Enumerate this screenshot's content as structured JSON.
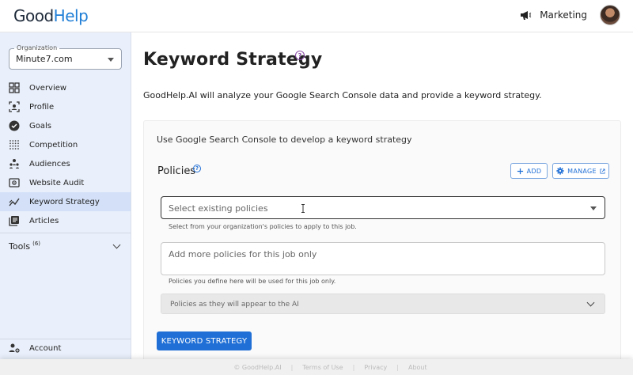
{
  "header": {
    "logo_good": "Good",
    "logo_help": "Help",
    "workspace_label": "Marketing"
  },
  "sidebar": {
    "org_legend": "Organization",
    "org_value": "Minute7.com",
    "items": [
      {
        "label": "Overview",
        "icon": "grid-icon"
      },
      {
        "label": "Profile",
        "icon": "profile-scan-icon"
      },
      {
        "label": "Goals",
        "icon": "check-circle-icon"
      },
      {
        "label": "Competition",
        "icon": "dots-grid-icon"
      },
      {
        "label": "Audiences",
        "icon": "audience-icon"
      },
      {
        "label": "Website Audit",
        "icon": "website-audit-icon"
      },
      {
        "label": "Keyword Strategy",
        "icon": "trend-chart-icon"
      },
      {
        "label": "Articles",
        "icon": "articles-icon"
      }
    ],
    "active_index": 6,
    "tools_label": "Tools",
    "tools_count": "(6)",
    "account_label": "Account"
  },
  "main": {
    "title": "Keyword Strategy",
    "intro": "GoodHelp.AI will analyze your Google Search Console data and provide a keyword strategy.",
    "card_title": "Use Google Search Console to develop a keyword strategy",
    "policies_label": "Policies",
    "add_button": "ADD",
    "manage_button": "MANAGE",
    "select_placeholder": "Select existing policies",
    "select_helper": "Select from your organization's policies to apply to this job.",
    "textarea_placeholder": "Add more policies for this job only",
    "textarea_helper": "Policies you define here will be used for this job only.",
    "accordion_label": "Policies as they will appear to the AI",
    "primary_button": "KEYWORD STRATEGY"
  },
  "footer": {
    "copyright": "© GoodHelp.AI",
    "terms": "Terms of Use",
    "privacy": "Privacy",
    "about": "About"
  },
  "colors": {
    "brand_blue": "#1f7ed6",
    "primary_button": "#1f6fd6",
    "sidebar_bg": "#eaf0fb",
    "sidebar_active": "#d3e0f7"
  }
}
